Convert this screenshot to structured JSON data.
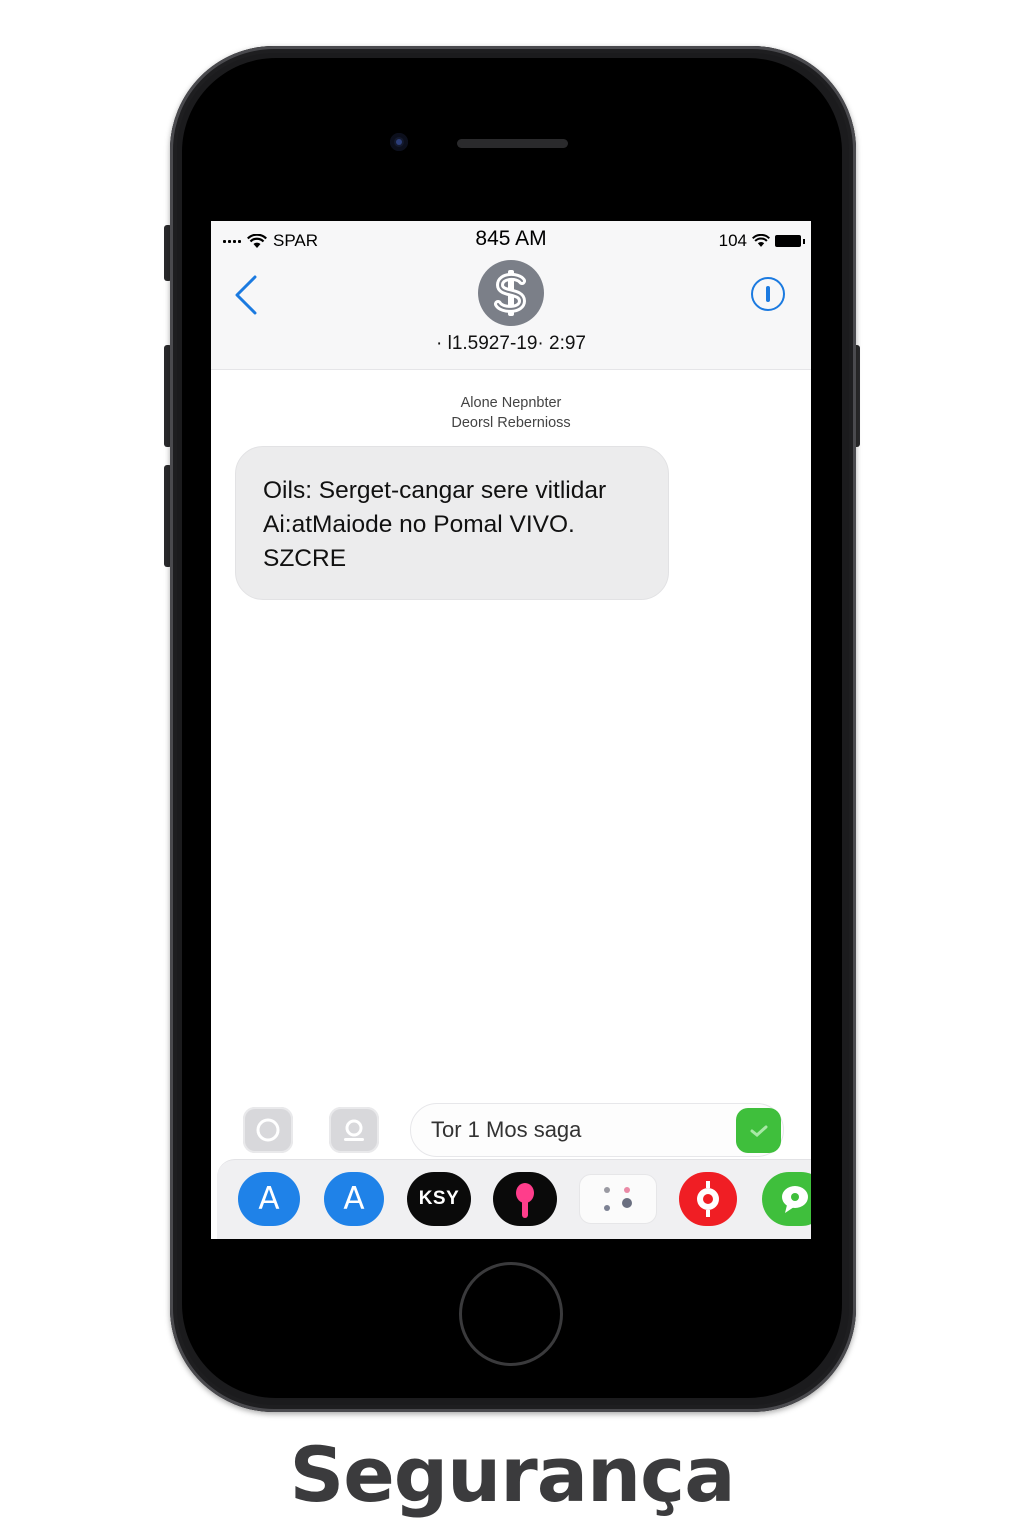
{
  "status_bar": {
    "carrier": "SPAR",
    "time": "845 AM",
    "battery_text": "104"
  },
  "header": {
    "contact_icon": "dollar-sign-icon",
    "contact_number": "· l1.5927-19· 2:97"
  },
  "thread": {
    "header_line1": "Alone Nepnbter",
    "header_line2": "Deorsl Rebernioss",
    "messages": [
      {
        "text": "Oils: Serget-cangar sere vitlidar\nAi:atMaiode no Pomal VIVO.\nSZCRE"
      }
    ]
  },
  "compose": {
    "placeholder": "Tor 1 Mos saga"
  },
  "app_drawer": {
    "apps": [
      {
        "icon": "app-store-icon",
        "label": "A",
        "color": "#1f82e8"
      },
      {
        "icon": "app-store-icon",
        "label": "A",
        "color": "#1f82e8"
      },
      {
        "icon": "ksy-app-icon",
        "label": "KSY",
        "color": "#0a0a0a"
      },
      {
        "icon": "pin-app-icon",
        "color": "#0a0a0a",
        "accent": "#ff3d8b"
      },
      {
        "icon": "dots-app-icon",
        "color": "#fbfbfb"
      },
      {
        "icon": "target-app-icon",
        "color": "#f01e24"
      },
      {
        "icon": "chat-app-icon",
        "color": "#3fbf3c"
      }
    ]
  },
  "caption": "Segurança",
  "colors": {
    "accent_blue": "#1b7ae0",
    "bubble_gray": "#ececed",
    "send_green": "#3fbf3c"
  }
}
